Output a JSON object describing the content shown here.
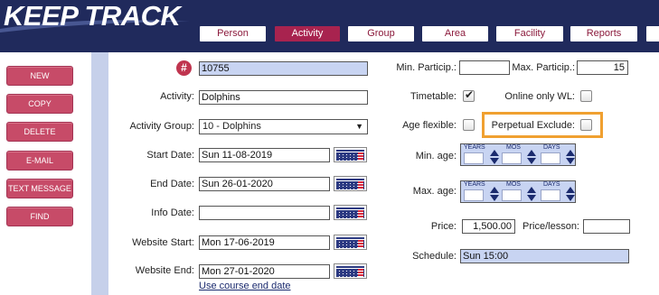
{
  "app": {
    "logo_text": "KEEP TRACK"
  },
  "tabs": [
    {
      "label": "Person"
    },
    {
      "label": "Activity"
    },
    {
      "label": "Group"
    },
    {
      "label": "Area"
    },
    {
      "label": "Facility"
    },
    {
      "label": "Reports"
    }
  ],
  "active_tab": "Activity",
  "sidebar": {
    "buttons": [
      {
        "label": "NEW"
      },
      {
        "label": "COPY"
      },
      {
        "label": "DELETE"
      },
      {
        "label": "E-MAIL"
      },
      {
        "label": "TEXT MESSAGE"
      },
      {
        "label": "FIND"
      }
    ]
  },
  "form": {
    "id_value": "10755",
    "activity_label": "Activity:",
    "activity_value": "Dolphins",
    "activity_group_label": "Activity Group:",
    "activity_group_value": "10 - Dolphins",
    "start_date_label": "Start Date:",
    "start_date_value": "Sun 11-08-2019",
    "end_date_label": "End Date:",
    "end_date_value": "Sun 26-01-2020",
    "info_date_label": "Info Date:",
    "info_date_value": "",
    "website_start_label": "Website Start:",
    "website_start_value": "Mon 17-06-2019",
    "website_end_label": "Website End:",
    "website_end_value": "Mon 27-01-2020",
    "use_course_end_link": "Use course end date",
    "min_particip_label": "Min. Particip.:",
    "min_particip_value": "",
    "max_particip_label": "Max. Particip.:",
    "max_particip_value": "15",
    "timetable_label": "Timetable:",
    "timetable_checked": true,
    "online_only_label": "Online only WL:",
    "online_only_checked": false,
    "age_flexible_label": "Age flexible:",
    "age_flexible_checked": false,
    "perpetual_exclude_label": "Perpetual Exclude:",
    "perpetual_exclude_checked": false,
    "min_age_label": "Min. age:",
    "max_age_label": "Max. age:",
    "age_years_label": "YEARS",
    "age_mos_label": "MOS",
    "age_days_label": "DAYS",
    "price_label": "Price:",
    "price_value": "1,500.00",
    "price_per_lesson_label": "Price/lesson:",
    "price_per_lesson_value": "",
    "schedule_label": "Schedule:",
    "schedule_value": "Sun 15:00"
  },
  "colors": {
    "header_bg": "#202a5c",
    "accent": "#a8234f",
    "highlight": "#f0a030",
    "field_blue": "#c8d4f2"
  }
}
